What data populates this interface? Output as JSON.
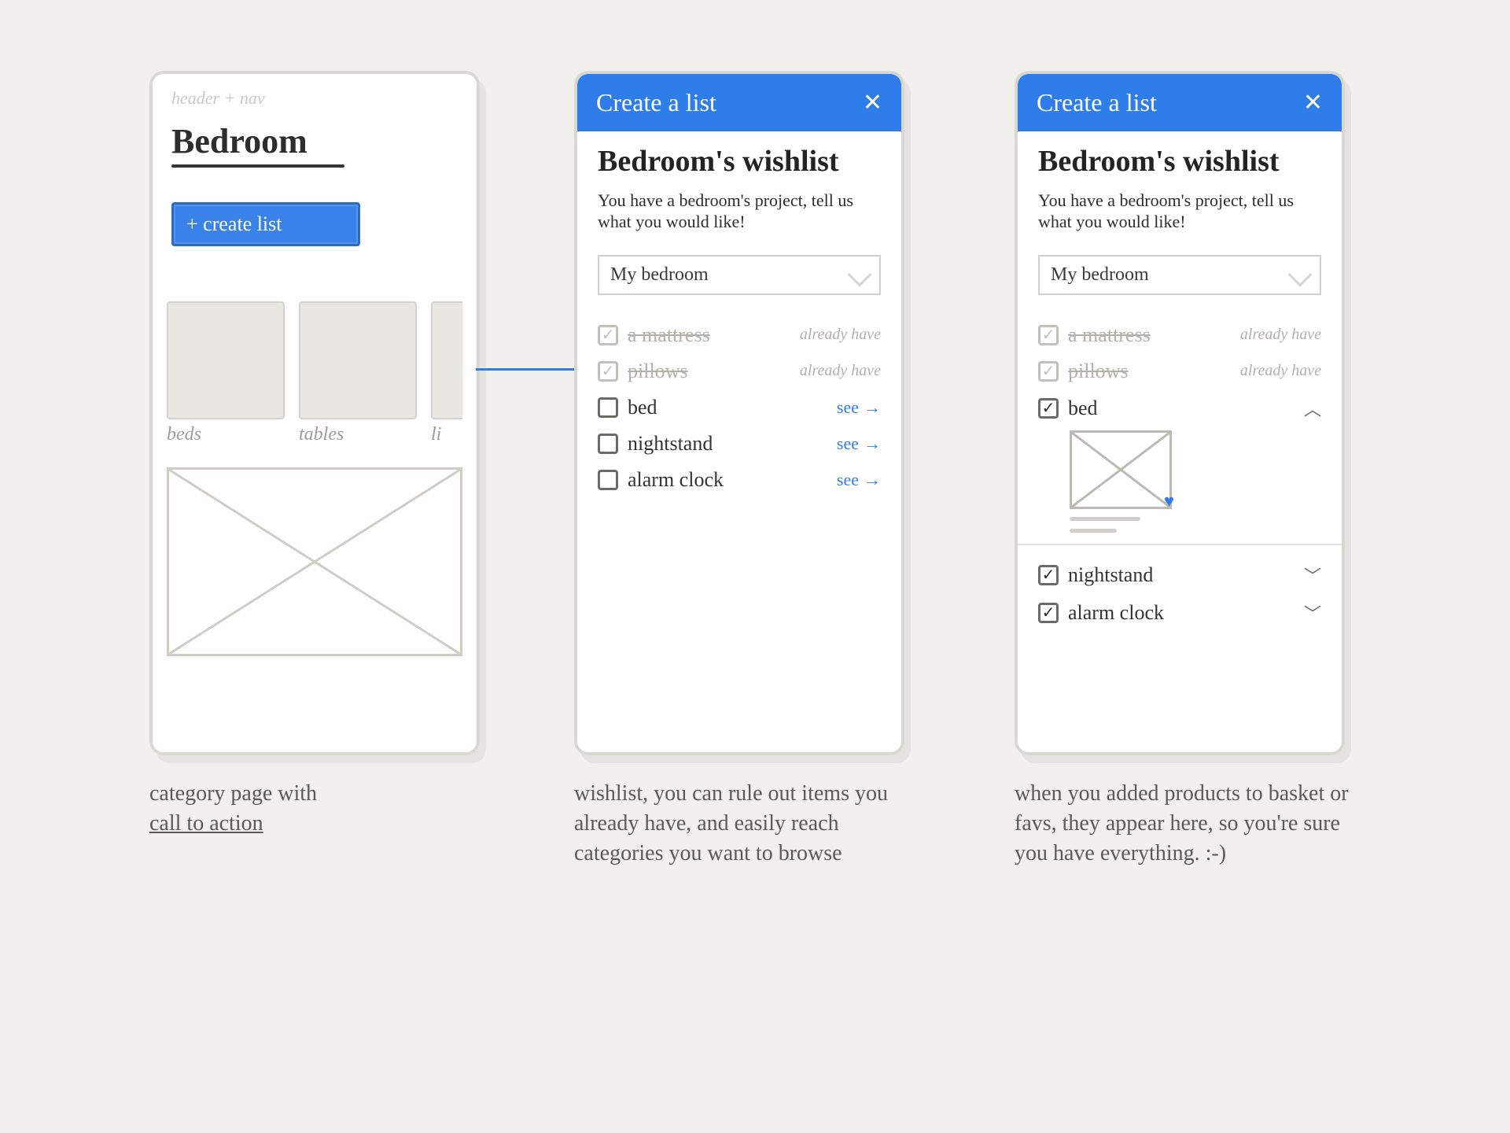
{
  "screen1": {
    "header_placeholder": "header + nav",
    "title": "Bedroom",
    "cta": "+ create list",
    "categories": [
      {
        "label": "beds"
      },
      {
        "label": "tables"
      },
      {
        "label": "li"
      }
    ],
    "caption_pre": "category page with",
    "caption_u": "call to action"
  },
  "screen2": {
    "modal_title": "Create a list",
    "heading": "Bedroom's wishlist",
    "sub": "You have a bedroom's project, tell us what you would like!",
    "list_name": "My bedroom",
    "items_have": [
      {
        "label": "a mattress",
        "status": "already have"
      },
      {
        "label": "pillows",
        "status": "already have"
      }
    ],
    "items_todo": [
      {
        "label": "bed",
        "action": "see"
      },
      {
        "label": "nightstand",
        "action": "see"
      },
      {
        "label": "alarm clock",
        "action": "see"
      }
    ],
    "caption": "wishlist, you can rule out items you already have, and easily reach categories you want to browse"
  },
  "screen3": {
    "modal_title": "Create a list",
    "heading": "Bedroom's wishlist",
    "sub": "You have a bedroom's project, tell us what you would like!",
    "list_name": "My bedroom",
    "items_have": [
      {
        "label": "a mattress",
        "status": "already have"
      },
      {
        "label": "pillows",
        "status": "already have"
      }
    ],
    "item_expanded": {
      "label": "bed"
    },
    "items_checked": [
      {
        "label": "nightstand"
      },
      {
        "label": "alarm clock"
      }
    ],
    "caption": "when you added products to basket or favs, they appear here, so you're sure you have everything.   :-)"
  }
}
